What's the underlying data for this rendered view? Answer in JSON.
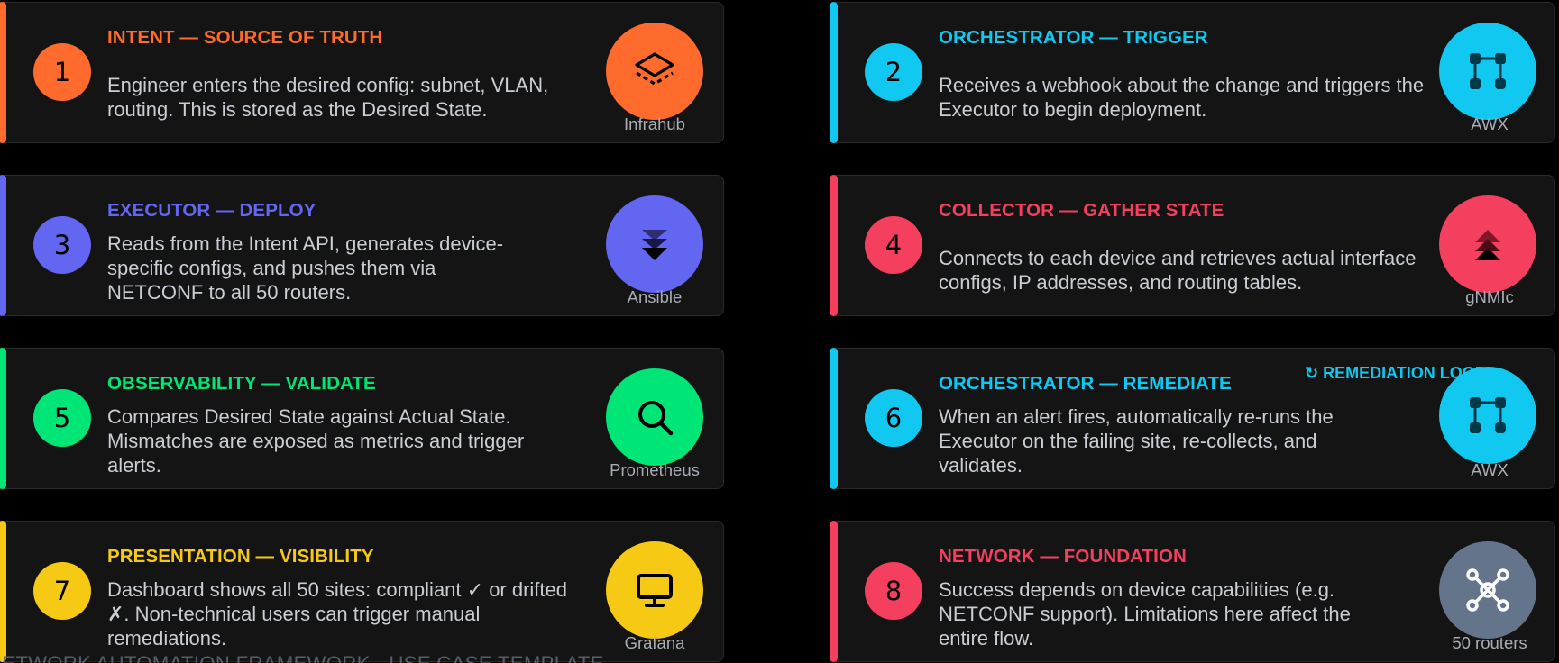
{
  "cards": [
    {
      "num": "1",
      "title": "INTENT — SOURCE OF TRUTH",
      "desc": "Engineer enters the desired config: subnet, VLAN, routing. This is stored as the Desired State.",
      "tool": "Infrahub",
      "icon": "layers-icon",
      "color": "#ff6b2c"
    },
    {
      "num": "2",
      "title": "ORCHESTRATOR — TRIGGER",
      "desc": "Receives a webhook about the change and triggers the Executor to begin deployment.",
      "tool": "AWX",
      "icon": "workflow-icon",
      "color": "#10c8f0"
    },
    {
      "num": "3",
      "title": "EXECUTOR — DEPLOY",
      "desc": "Reads from the Intent API, generates device-specific configs, and pushes them via NETCONF to all 50 routers.",
      "tool": "Ansible",
      "icon": "deploy-down-icon",
      "color": "#6366f1"
    },
    {
      "num": "4",
      "title": "COLLECTOR — GATHER STATE",
      "desc": "Connects to each device and retrieves actual interface configs, IP addresses, and routing tables.",
      "tool": "gNMIc",
      "icon": "collect-up-icon",
      "color": "#f43f5e"
    },
    {
      "num": "5",
      "title": "OBSERVABILITY — VALIDATE",
      "desc": "Compares Desired State against Actual State. Mismatches are exposed as metrics and trigger alerts.",
      "tool": "Prometheus",
      "icon": "search-icon",
      "color": "#00e676"
    },
    {
      "num": "6",
      "title": "ORCHESTRATOR — REMEDIATE",
      "desc": "When an alert fires, automatically re-runs the Executor on the failing site, re-collects, and validates.",
      "tool": "AWX",
      "icon": "workflow-icon",
      "color": "#10c8f0",
      "tag": "↻ REMEDIATION LOOP"
    },
    {
      "num": "7",
      "title": "PRESENTATION — VISIBILITY",
      "desc": "Dashboard shows all 50 sites: compliant ✓ or drifted ✗. Non-technical users can trigger manual remediations.",
      "tool": "Grafana",
      "icon": "monitor-icon",
      "color": "#f6c915"
    },
    {
      "num": "8",
      "title": "NETWORK — FOUNDATION",
      "desc": "Success depends on device capabilities (e.g. NETCONF support). Limitations here affect the entire flow.",
      "tool": "50 routers",
      "icon": "network-hub-icon",
      "color": "#f43f5e",
      "tool_color": "#64748b"
    }
  ],
  "footer": "NETWORK AUTOMATION FRAMEWORK · USE CASE TEMPLATE"
}
